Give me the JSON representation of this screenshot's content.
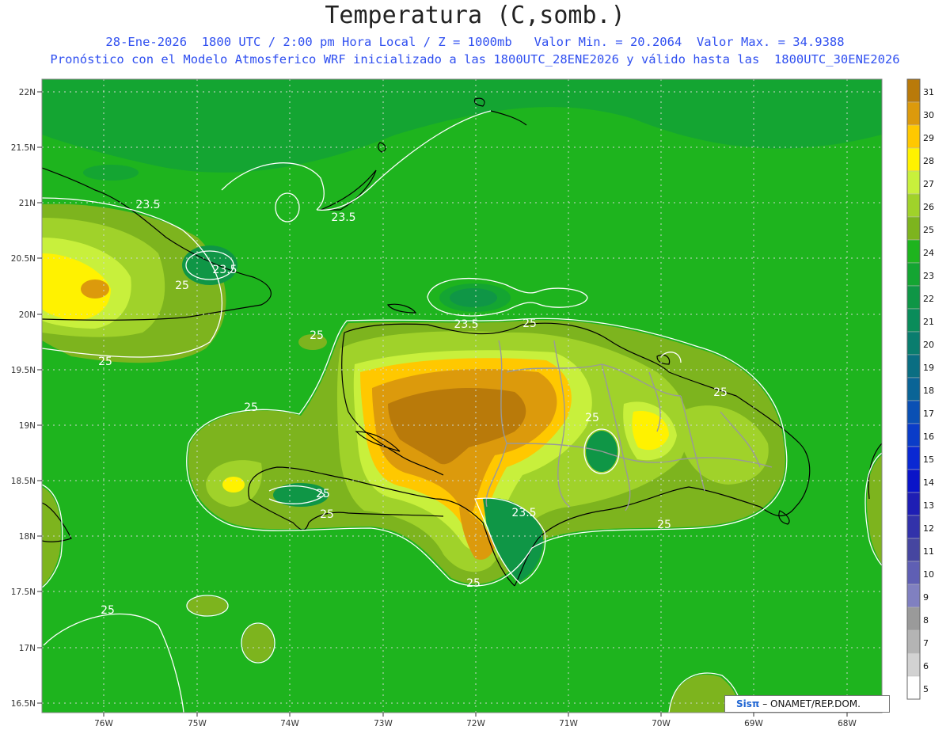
{
  "header": {
    "title": "Temperatura (C,somb.)",
    "subtitle1": "28-Ene-2026  1800 UTC / 2:00 pm Hora Local / Z = 1000mb   Valor Min. = 20.2064  Valor Max. = 34.9388",
    "subtitle2": "Pronóstico con el Modelo Atmosferico WRF inicializado a las 1800UTC_28ENE2026 y válido hasta las  1800UTC_30ENE2026"
  },
  "axes": {
    "lat_labels": [
      "22N",
      "21.5N",
      "21N",
      "20.5N",
      "20N",
      "19.5N",
      "19N",
      "18.5N",
      "18N",
      "17.5N",
      "17N",
      "16.5N"
    ],
    "lon_labels": [
      "76W",
      "75W",
      "74W",
      "73W",
      "72W",
      "71W",
      "70W",
      "69W",
      "68W"
    ]
  },
  "contour_labels": [
    "23.5",
    "23.5",
    "23.5",
    "23.5",
    "23.5",
    "25",
    "25",
    "25",
    "25",
    "25",
    "25",
    "25",
    "25",
    "25",
    "25",
    "25",
    "25"
  ],
  "colorbar": {
    "labels": [
      "31",
      "30",
      "29",
      "28",
      "27",
      "26",
      "25",
      "24",
      "23",
      "22",
      "21",
      "20",
      "19",
      "18",
      "17",
      "16",
      "15",
      "14",
      "13",
      "12",
      "11",
      "10",
      "9",
      "8",
      "7",
      "6",
      "5"
    ],
    "colors": [
      "#b97a0a",
      "#dc9a0c",
      "#ffc800",
      "#fff200",
      "#c8f03c",
      "#a0d22a",
      "#7db41e",
      "#1eb41e",
      "#14a532",
      "#0f9646",
      "#0a8c5a",
      "#0a7d6e",
      "#0a6e82",
      "#0a6496",
      "#0a50b4",
      "#0a3cc8",
      "#0a28d2",
      "#0a14c8",
      "#1e1eb4",
      "#3232aa",
      "#4646a0",
      "#5f5fb4",
      "#8080c0",
      "#9a9a9a",
      "#b4b4b4",
      "#d2d2d2",
      "#ffffff"
    ]
  },
  "credit": {
    "logo": "Sisπ",
    "text": "– ONAMET/REP.DOM."
  }
}
